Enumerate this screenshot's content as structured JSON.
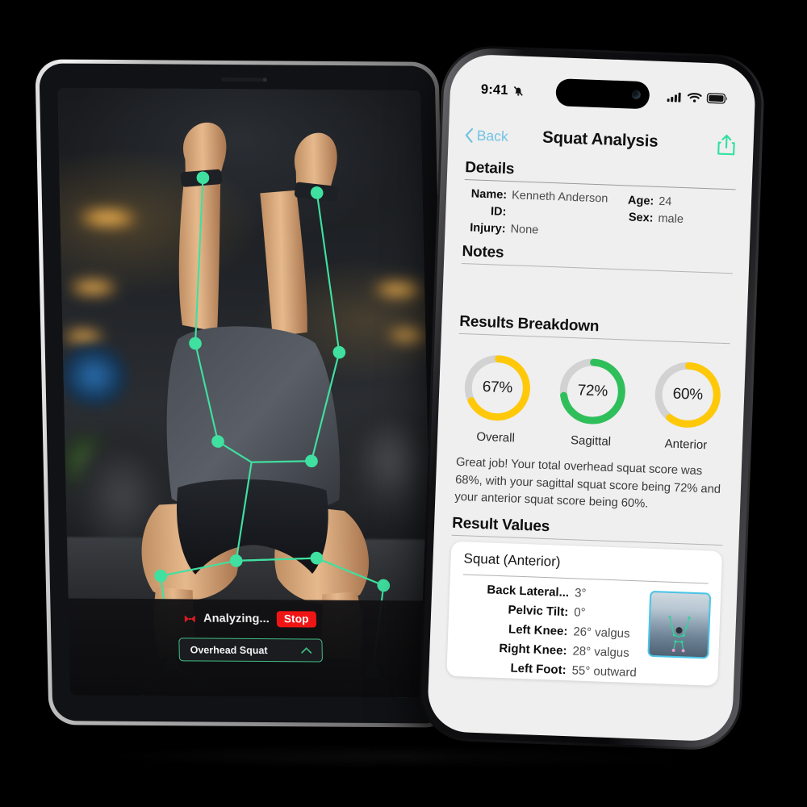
{
  "tablet": {
    "overlay_color": "#3fe0a0",
    "status": {
      "icon": "analyzing-icon",
      "label": "Analyzing...",
      "stop_label": "Stop",
      "stop_color": "#f01515"
    },
    "exercise_select": {
      "value": "Overhead Squat",
      "chevron": "chevron-up-icon",
      "border_color": "#3fbf86"
    }
  },
  "phone": {
    "status_bar": {
      "time": "9:41",
      "silent_icon": "bell-slash-icon",
      "cellular_icon": "signal-bars-icon",
      "wifi_icon": "wifi-icon",
      "battery_icon": "battery-icon"
    },
    "nav": {
      "back_label": "Back",
      "back_icon": "chevron-left-icon",
      "back_color": "#70c3e3",
      "title": "Squat Analysis",
      "share_icon": "share-icon",
      "share_color": "#2fe0a0"
    },
    "details": {
      "heading": "Details",
      "left_rows": [
        {
          "key": "Name:",
          "value": "Kenneth Anderson"
        },
        {
          "key": "ID:",
          "value": ""
        },
        {
          "key": "Injury:",
          "value": "None"
        }
      ],
      "right_rows": [
        {
          "key": "Age:",
          "value": "24"
        },
        {
          "key": "Sex:",
          "value": "male"
        }
      ]
    },
    "notes": {
      "heading": "Notes",
      "body": ""
    },
    "results_breakdown": {
      "heading": "Results Breakdown",
      "track_color": "#d2d2d2",
      "gauges": [
        {
          "label": "Overall",
          "value": 67,
          "display": "67%",
          "color": "#ffc90a"
        },
        {
          "label": "Sagittal",
          "value": 72,
          "display": "72%",
          "color": "#2fbf5a"
        },
        {
          "label": "Anterior",
          "value": 60,
          "display": "60%",
          "color": "#ffc90a"
        }
      ]
    },
    "summary_text": "Great job! Your total overhead squat score was 68%, with your sagittal squat score being 72% and your anterior squat score being 60%.",
    "result_values": {
      "heading": "Result Values",
      "card_title": "Squat (Anterior)",
      "rows": [
        {
          "key": "Back Lateral...",
          "value": "3°"
        },
        {
          "key": "Pelvic Tilt:",
          "value": "0°"
        },
        {
          "key": "Left Knee:",
          "value": "26° valgus"
        },
        {
          "key": "Right Knee:",
          "value": "28° valgus"
        },
        {
          "key": "Left Foot:",
          "value": "55° outward"
        }
      ],
      "thumbnail": {
        "name": "pose-thumbnail",
        "border_color": "#49c6e8"
      }
    }
  }
}
